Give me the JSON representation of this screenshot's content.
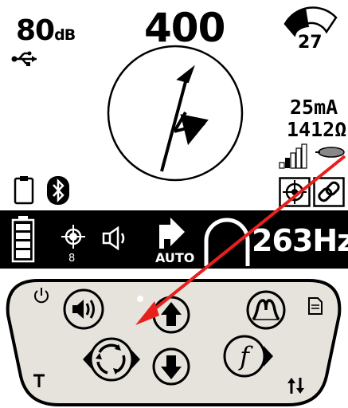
{
  "top": {
    "signal_value": "80",
    "signal_unit": "dB",
    "depth_value": "400",
    "gauge_value": "27",
    "current": "25mA",
    "resistance": "1412Ω"
  },
  "status_bar": {
    "gps_satellites": "8",
    "mode_label": "AUTO",
    "frequency": "263Hz"
  },
  "icons": [
    "usb-icon",
    "gauge-icon",
    "compass-icon",
    "clipboard-icon",
    "bluetooth-icon",
    "signal-bars-icon",
    "target-icon",
    "link-icon",
    "battery-icon",
    "gps-icon",
    "speaker-icon",
    "mode-arrow-icon",
    "peak-icon",
    "power-icon",
    "menu-icon",
    "volume-button",
    "up-button",
    "peak-mode-button",
    "cycle-button",
    "down-button",
    "frequency-button",
    "depth-icon",
    "sort-icon"
  ],
  "colors": {
    "screen_bg": "#ffffff",
    "status_bar_bg": "#000000",
    "keypad_bg": "#e6e2dc",
    "annotation_arrow": "#e8201c"
  }
}
